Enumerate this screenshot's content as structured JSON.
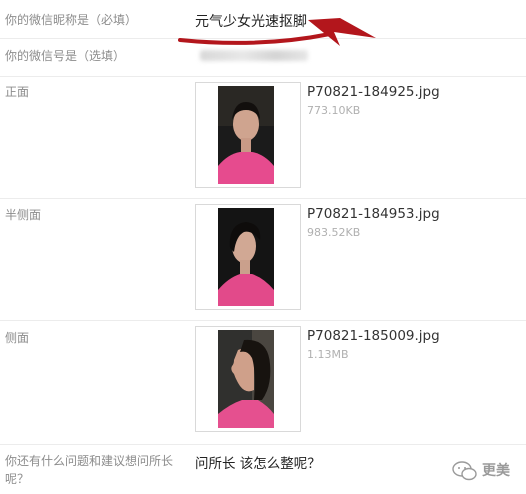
{
  "form": {
    "nickname": {
      "label": "你的微信昵称是（必填）",
      "value": "元气少女光速抠脚"
    },
    "wechat_id": {
      "label": "你的微信号是（选填）"
    },
    "photos": [
      {
        "label": "正面",
        "filename": "P70821-184925.jpg",
        "size": "773.10KB"
      },
      {
        "label": "半侧面",
        "filename": "P70821-184953.jpg",
        "size": "983.52KB"
      },
      {
        "label": "侧面",
        "filename": "P70821-185009.jpg",
        "size": "1.13MB"
      }
    ],
    "question": {
      "label": "你还有什么问题和建议想问所长呢？",
      "value": "问所长 该怎么整呢？"
    }
  },
  "annotation": {
    "arrow_color": "#b3161c"
  },
  "watermark": {
    "text": "更美"
  }
}
